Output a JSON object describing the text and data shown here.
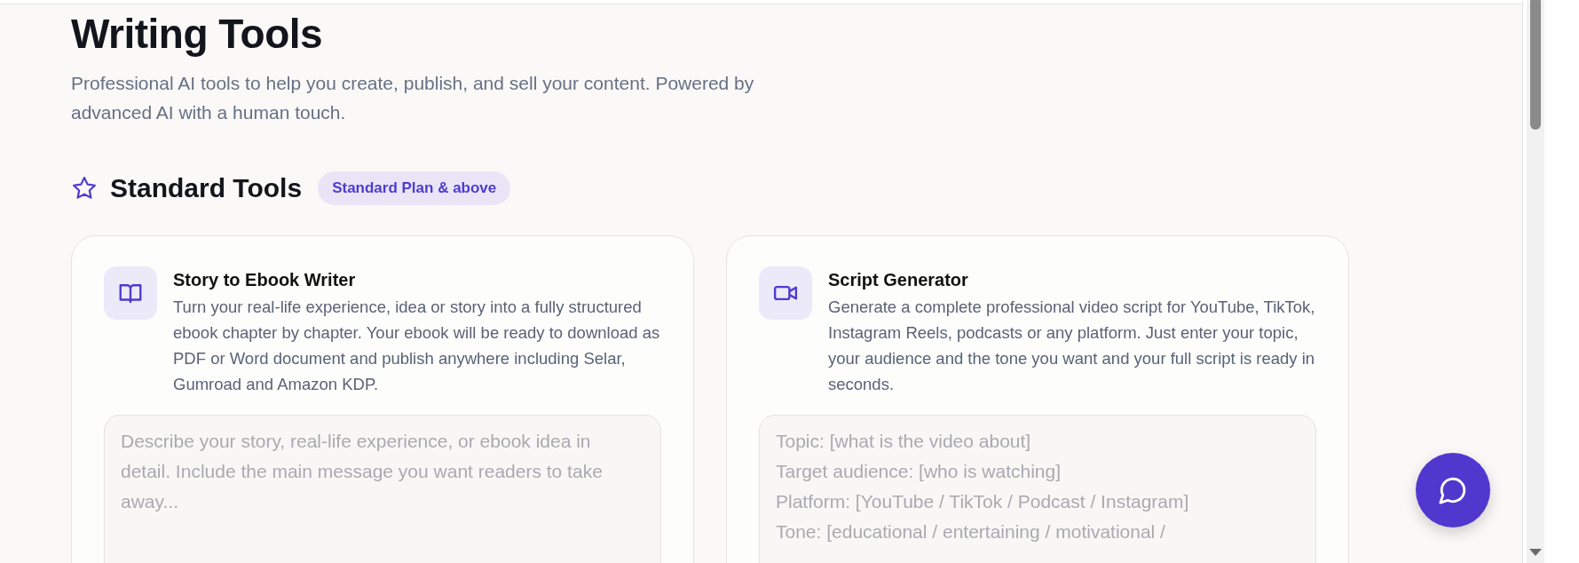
{
  "page": {
    "title": "Writing Tools",
    "subtitle": "Professional AI tools to help you create, publish, and sell your content. Powered by advanced AI with a human touch."
  },
  "section": {
    "title": "Standard Tools",
    "badge": "Standard Plan & above"
  },
  "tools": [
    {
      "kind": "book",
      "title": "Story to Ebook Writer",
      "description": "Turn your real-life experience, idea or story into a fully structured ebook chapter by chapter. Your ebook will be ready to download as PDF or Word document and publish anywhere including Selar, Gumroad and Amazon KDP.",
      "placeholder": "Describe your story, real-life experience, or ebook idea in detail. Include the main message you want readers to take away..."
    },
    {
      "kind": "video",
      "title": "Script Generator",
      "description": "Generate a complete professional video script for YouTube, TikTok, Instagram Reels, podcasts or any platform. Just enter your topic, your audience and the tone you want and your full script is ready in seconds.",
      "placeholder": "Topic: [what is the video about]\nTarget audience: [who is watching]\nPlatform: [YouTube / TikTok / Podcast / Instagram]\nTone: [educational / entertaining / motivational /"
    }
  ]
}
